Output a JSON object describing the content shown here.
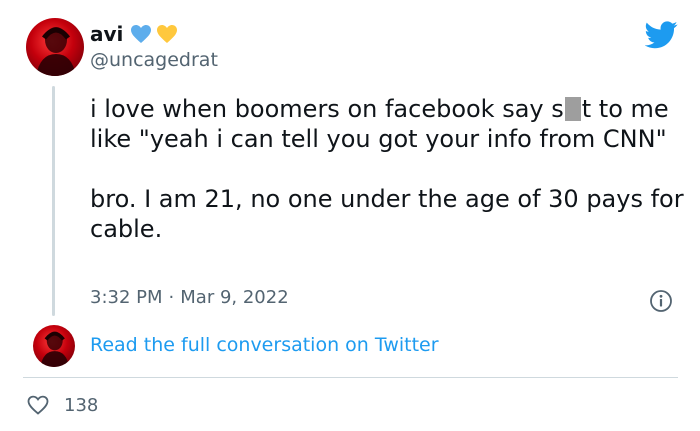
{
  "author": {
    "display_name": "avi",
    "handle": "@uncagedrat",
    "name_emojis": [
      "blue-heart-icon",
      "yellow-heart-icon"
    ]
  },
  "tweet": {
    "paragraph1_before": "i love when boomers on facebook say s",
    "paragraph1_after": "t to me like \"yeah i can tell you got your info from CNN\"",
    "paragraph2": "bro. I am 21, no one under the age of 30 pays for cable.",
    "time": "3:32 PM",
    "separator": "·",
    "date": "Mar 9, 2022"
  },
  "reply_link": "Read the full conversation on Twitter",
  "likes": {
    "count": "138"
  },
  "colors": {
    "link": "#1d9bf0",
    "secondary_text": "#536471",
    "blue_heart": "#5dadec",
    "yellow_heart": "#ffc83d",
    "twitter_blue": "#1d9bf0"
  }
}
